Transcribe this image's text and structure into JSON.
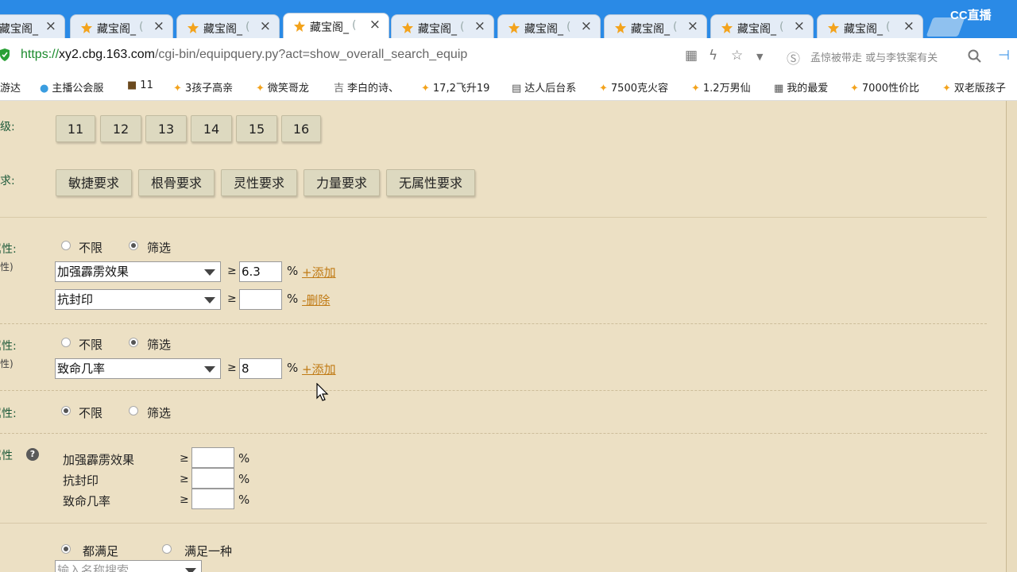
{
  "browser": {
    "tabs": [
      {
        "title": "藏宝阁_",
        "active": false
      },
      {
        "title": "藏宝阁_",
        "active": false
      },
      {
        "title": "藏宝阁_",
        "active": false
      },
      {
        "title": "藏宝阁_",
        "active": true
      },
      {
        "title": "藏宝阁_",
        "active": false
      },
      {
        "title": "藏宝阁_",
        "active": false
      },
      {
        "title": "藏宝阁_",
        "active": false
      },
      {
        "title": "藏宝阁_",
        "active": false
      },
      {
        "title": "藏宝阁_",
        "active": false
      }
    ],
    "tab_fade": "(",
    "close_glyph": "×",
    "cc_logo": "CC直播",
    "url_proto": "https://",
    "url_host": "xy2.cbg.163.com",
    "url_path": "/cgi-bin/equipquery.py?act=show_overall_search_equip",
    "search_hint": "孟惊被带走 或与李铁案有关",
    "bookmarks": [
      "游达",
      "主播公会服",
      "11",
      "3孩子高亲",
      "微笑哥龙",
      "李白的诗、",
      "17,2飞升19",
      "达人后台系",
      "7500克火容",
      "1.2万男仙",
      "我的最爱",
      "7000性价比",
      "双老版孩子"
    ]
  },
  "level": {
    "label": "等级:",
    "buttons": [
      "11",
      "12",
      "13",
      "14",
      "15",
      "16"
    ]
  },
  "requirement": {
    "label": "要求:",
    "buttons": [
      "敏捷要求",
      "根骨要求",
      "灵性要求",
      "力量要求",
      "无属性要求"
    ]
  },
  "attr1": {
    "label": "属性:",
    "sub": "属性)",
    "radio_unlimited": "不限",
    "radio_filter": "筛选",
    "selected": "filter",
    "rows": [
      {
        "select": "加强霹雳效果",
        "ge": "≥",
        "value": "6.3",
        "unit": "%",
        "action": "+添加"
      },
      {
        "select": "抗封印",
        "ge": "≥",
        "value": "",
        "unit": "%",
        "action": "-删除"
      }
    ]
  },
  "attr2": {
    "label": "属性:",
    "sub": "属性)",
    "radio_unlimited": "不限",
    "radio_filter": "筛选",
    "selected": "filter",
    "rows": [
      {
        "select": "致命几率",
        "ge": "≥",
        "value": "8",
        "unit": "%",
        "action": "+添加"
      }
    ]
  },
  "attr3": {
    "label": "属性:",
    "radio_unlimited": "不限",
    "radio_filter": "筛选",
    "selected": "unlimited"
  },
  "attr4": {
    "label": "属性",
    "help": "?",
    "rows": [
      {
        "name": "加强霹雳效果",
        "ge": "≥",
        "value": "",
        "unit": "%"
      },
      {
        "name": "抗封印",
        "ge": "≥",
        "value": "",
        "unit": "%"
      },
      {
        "name": "致命几率",
        "ge": "≥",
        "value": "",
        "unit": "%"
      }
    ]
  },
  "match": {
    "radio_all": "都满足",
    "radio_one": "满足一种",
    "selected": "all",
    "input_placeholder": "输入名称搜索"
  },
  "colors": {
    "tabbar": "#2a8ae6",
    "page_bg": "#ece0c4",
    "label_green": "#1e5a3a",
    "link_orange": "#c07a14"
  }
}
